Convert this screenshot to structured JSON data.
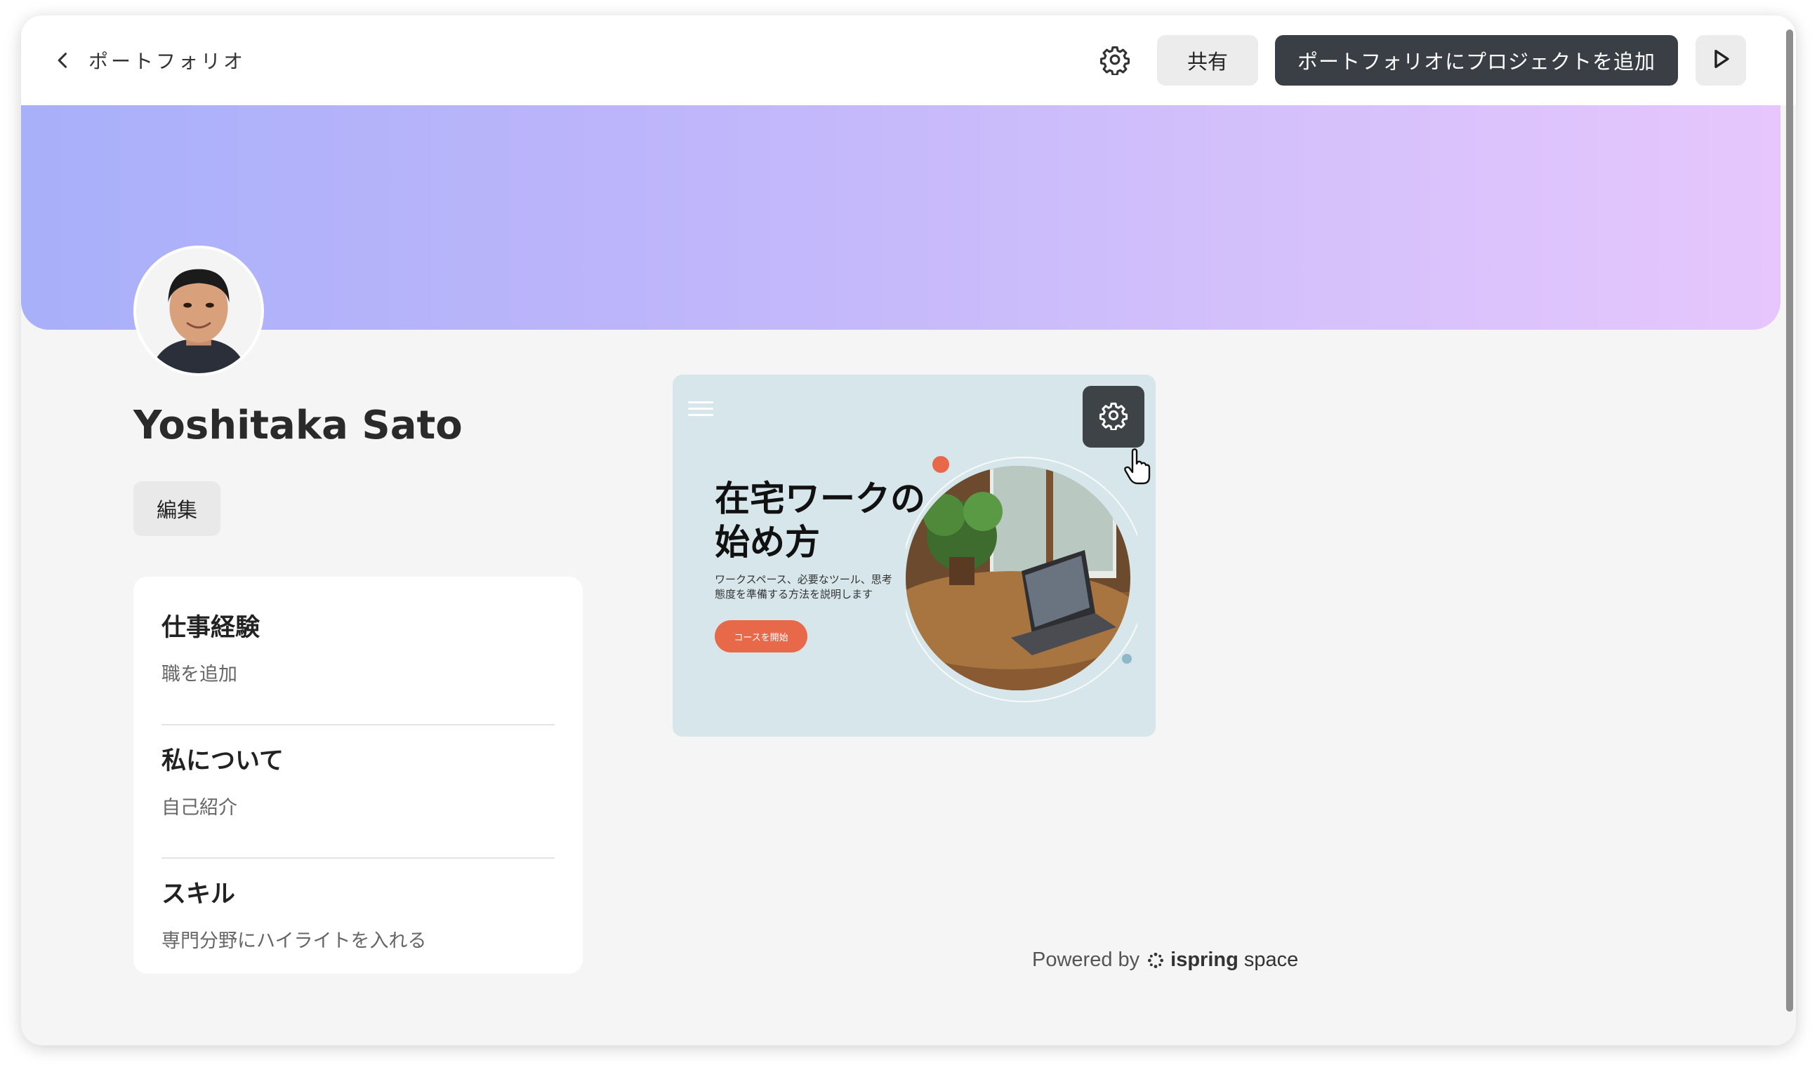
{
  "header": {
    "back_label": "ポートフォリオ",
    "share_label": "共有",
    "add_project_label": "ポートフォリオにプロジェクトを追加",
    "icons": [
      "chevron-left-icon",
      "gear-icon",
      "play-icon"
    ]
  },
  "profile": {
    "name": "Yoshitaka Sato",
    "edit_label": "編集"
  },
  "info_sections": [
    {
      "title": "仕事経験",
      "subtitle": "職を追加"
    },
    {
      "title": "私について",
      "subtitle": "自己紹介"
    },
    {
      "title": "スキル",
      "subtitle": "専門分野にハイライトを入れる"
    }
  ],
  "course_card": {
    "title": "在宅ワークの始め方",
    "description": "ワークスペース、必要なツール、思考態度を準備する方法を説明します",
    "cta_label": "コースを開始"
  },
  "footer": {
    "powered_by": "Powered by",
    "brand_bold": "ispring",
    "brand_rest": "space"
  },
  "colors": {
    "primary_button": "#3a3f45",
    "banner_start": "#a8b0f9",
    "banner_end": "#e6c6fc",
    "accent_orange": "#e8684a",
    "card_bg": "#d6e6ea"
  }
}
